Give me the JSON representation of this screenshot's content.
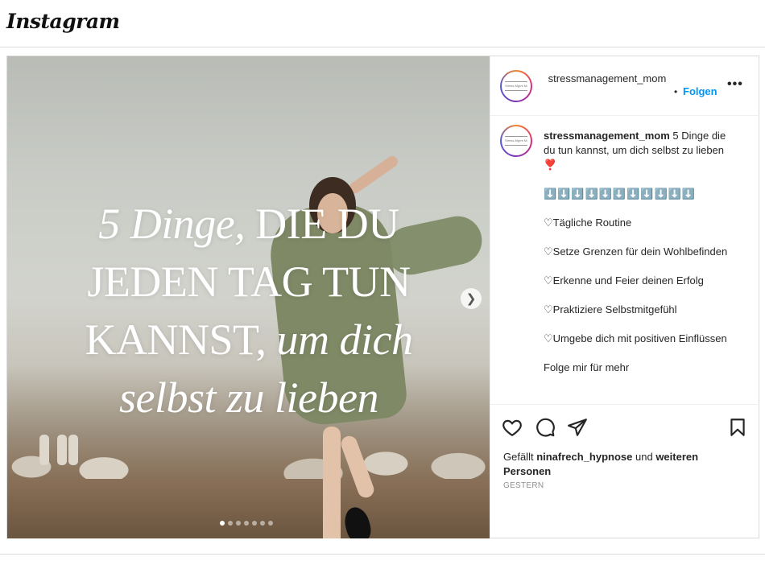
{
  "topbar": {
    "logo": "Instagram"
  },
  "post": {
    "media": {
      "overlay_line1_italic": "5 Dinge,",
      "overlay_line1_rest": " DIE DU",
      "overlay_line2": "JEDEN TAG TUN",
      "overlay_line3_upper": "KANNST,",
      "overlay_line3_italic": " um dich",
      "overlay_line4_italic": "selbst zu lieben",
      "next_icon": "chevron-right-icon",
      "carousel_dots": 7,
      "active_dot": 1
    },
    "header": {
      "username": "stressmanagement_mom",
      "separator": "•",
      "follow_label": "Folgen",
      "more_label": "•••",
      "avatar_text": "Stress-Mgmt Mom"
    },
    "caption": {
      "username": "stressmanagement_mom",
      "intro": " 5 Dinge die du tun kannst, um dich selbst zu lieben ❣️",
      "blocks": "⬇️⬇️⬇️⬇️⬇️⬇️⬇️⬇️⬇️⬇️⬇️",
      "items": [
        "♡Tägliche Routine",
        "♡Setze Grenzen für dein Wohlbefinden",
        "♡Erkenne und Feier deinen Erfolg",
        "♡Praktiziere Selbstmitgefühl",
        "♡Umgebe dich mit positiven Einflüssen",
        "Folge mir für mehr"
      ]
    },
    "actions": {
      "like_icon": "heart-icon",
      "comment_icon": "comment-icon",
      "share_icon": "paper-plane-icon",
      "save_icon": "bookmark-icon"
    },
    "likes": {
      "prefix": "Gefällt ",
      "user": "ninafrech_hypnose",
      "middle": " und ",
      "others": "weiteren Personen"
    },
    "date": "GESTERN"
  }
}
